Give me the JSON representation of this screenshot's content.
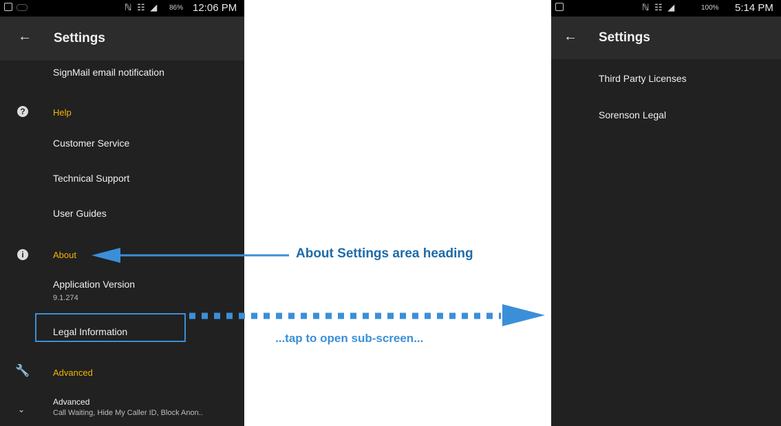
{
  "left_phone": {
    "status": {
      "icons": "ℕ ☷ ◢",
      "battery": "86%",
      "time": "12:06 PM"
    },
    "appbar": {
      "back": "←",
      "title": "Settings"
    },
    "items": {
      "signmail": "SignMail email notification",
      "help_section": "Help",
      "customer_service": "Customer Service",
      "technical_support": "Technical Support",
      "user_guides": "User Guides",
      "about_section": "About",
      "app_version": "Application Version",
      "app_version_value": "9.1.274",
      "legal_information": "Legal Information",
      "advanced_section": "Advanced",
      "advanced": "Advanced",
      "advanced_sub": "Call Waiting, Hide My Caller ID, Block Anon.."
    },
    "icons": {
      "help": "?",
      "about": "i",
      "wrench": "🔧",
      "chevron": "⌄"
    }
  },
  "right_phone": {
    "status": {
      "icons": "ℕ ☷ ◢",
      "battery": "100%",
      "time": "5:14 PM"
    },
    "appbar": {
      "back": "←",
      "title": "Settings"
    },
    "items": {
      "third_party": "Third Party Licenses",
      "sorenson_legal": "Sorenson Legal"
    }
  },
  "annotations": {
    "about_heading": "About Settings area heading",
    "tap_text": "...tap to open sub-screen..."
  },
  "colors": {
    "section": "#f4b400",
    "annotation_dark": "#1e6aa8",
    "annotation_light": "#3b8fd8",
    "phone_bg": "#212121"
  }
}
